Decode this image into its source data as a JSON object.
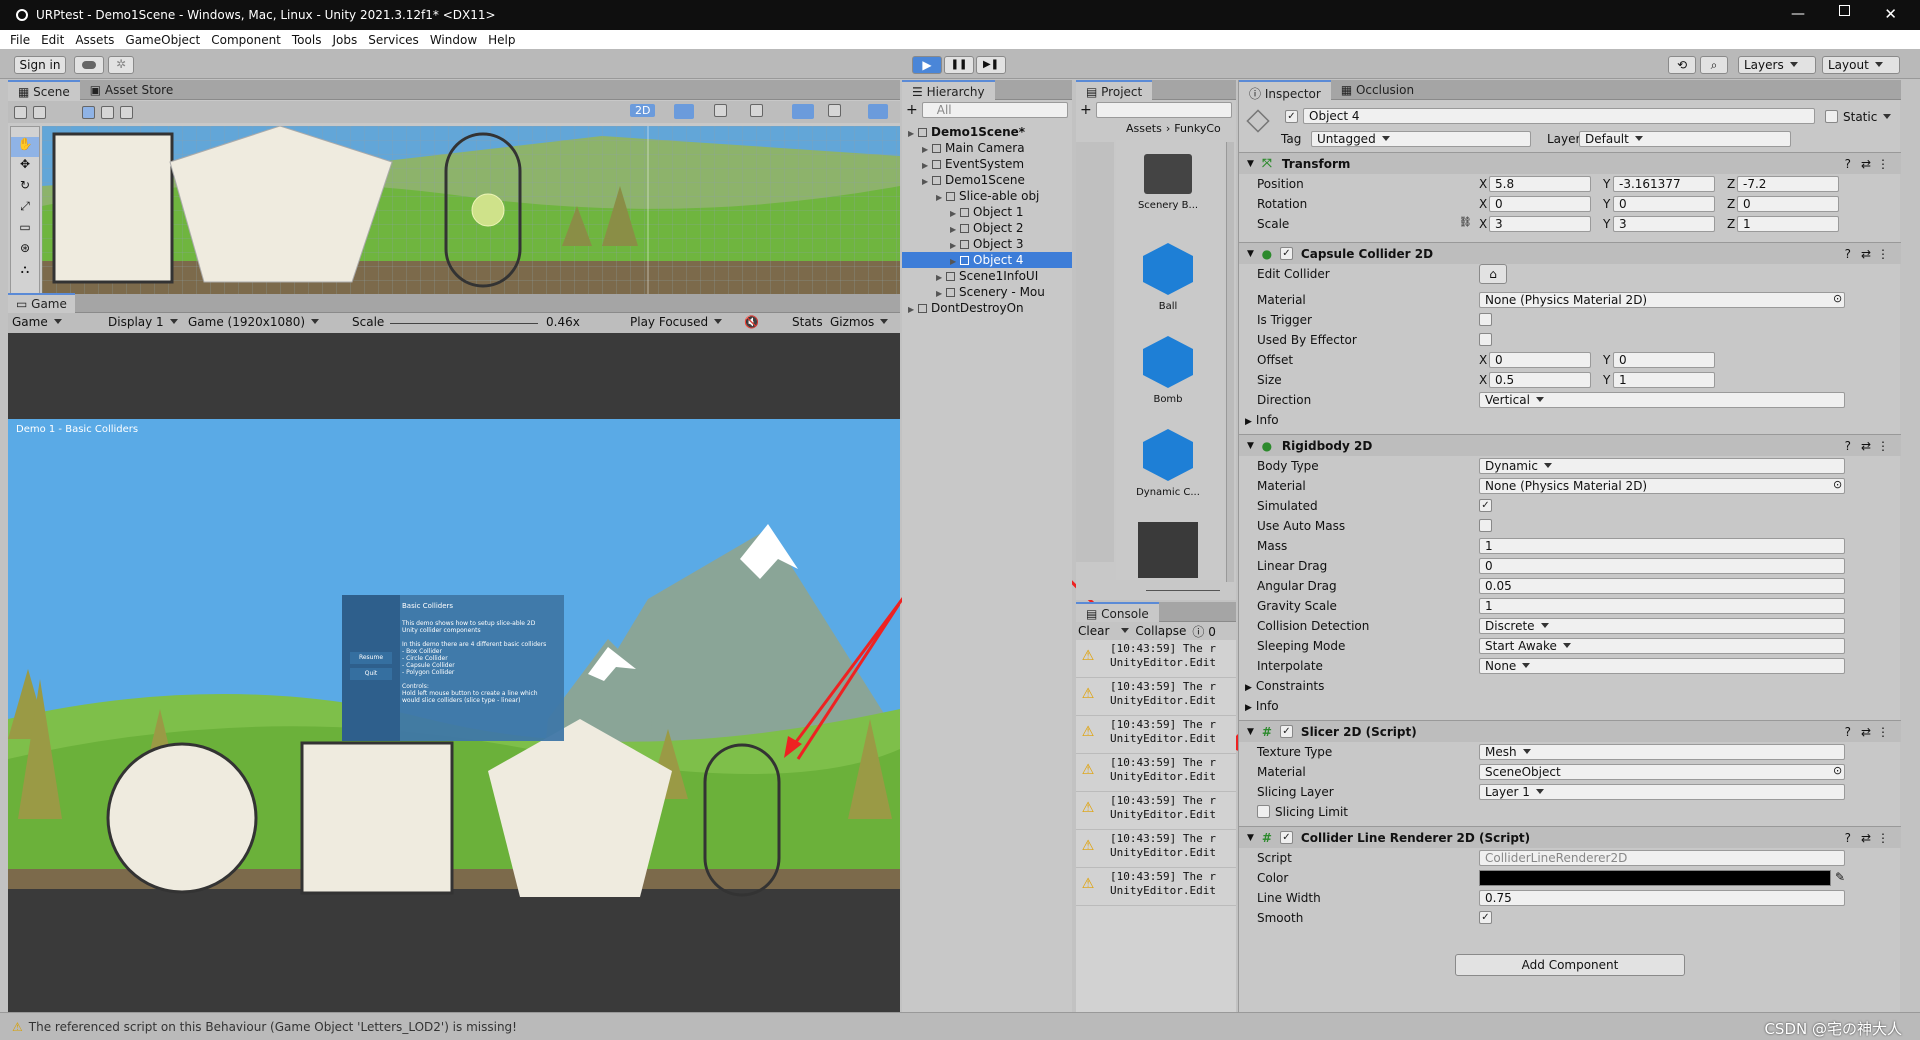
{
  "titlebar": {
    "title": "URPtest - Demo1Scene - Windows, Mac, Linux - Unity 2021.3.12f1* <DX11>"
  },
  "menu": [
    "File",
    "Edit",
    "Assets",
    "GameObject",
    "Component",
    "Tools",
    "Jobs",
    "Services",
    "Window",
    "Help"
  ],
  "toolbar": {
    "sign_in": "Sign in",
    "layers": "Layers",
    "layout": "Layout"
  },
  "scene": {
    "tab_scene": "Scene",
    "tab_asset_store": "Asset Store",
    "mode_2d": "2D"
  },
  "game": {
    "tab": "Game",
    "view": "Game",
    "display": "Display 1",
    "resolution": "Game (1920x1080)",
    "scale_label": "Scale",
    "scale_value": "0.46x",
    "play_focused": "Play Focused",
    "stats": "Stats",
    "gizmos": "Gizmos",
    "canvas_title": "Demo 1 - Basic Colliders",
    "menu_title": "Basic Colliders",
    "menu_text": [
      "This demo shows how to setup slice-able 2D",
      "Unity collider components",
      "",
      "In this demo there are 4 different basic colliders",
      "- Box Collider",
      "- Circle Collider",
      "- Capsule Collider",
      "- Polygon Collider",
      "",
      "Controls:",
      "Hold left mouse button to create a line which",
      "would slice colliders (slice type - linear)"
    ],
    "resume": "Resume",
    "quit": "Quit"
  },
  "hierarchy": {
    "tab": "Hierarchy",
    "search": "All",
    "items": [
      {
        "label": "Demo1Scene*",
        "depth": 0,
        "bold": true
      },
      {
        "label": "Main Camera",
        "depth": 1
      },
      {
        "label": "EventSystem",
        "depth": 1
      },
      {
        "label": "Demo1Scene",
        "depth": 1
      },
      {
        "label": "Slice-able obj",
        "depth": 2
      },
      {
        "label": "Object 1",
        "depth": 3
      },
      {
        "label": "Object 2",
        "depth": 3
      },
      {
        "label": "Object 3",
        "depth": 3
      },
      {
        "label": "Object 4",
        "depth": 3,
        "selected": true
      },
      {
        "label": "Scene1InfoUI",
        "depth": 2
      },
      {
        "label": "Scenery - Mou",
        "depth": 2
      },
      {
        "label": "DontDestroyOn",
        "depth": 0
      }
    ]
  },
  "project": {
    "tab": "Project",
    "breadcrumb_root": "Assets",
    "breadcrumb_child": "FunkyCo",
    "assets": [
      {
        "label": "Scenery B...",
        "kind": "folder"
      },
      {
        "label": "Ball",
        "kind": "cube"
      },
      {
        "label": "Bomb",
        "kind": "cube"
      },
      {
        "label": "Dynamic C...",
        "kind": "cube"
      },
      {
        "label": "",
        "kind": "image"
      }
    ]
  },
  "console": {
    "tab": "Console",
    "clear": "Clear",
    "collapse": "Collapse",
    "count": "0",
    "entries": [
      {
        "line1": "[10:43:59] The r",
        "line2": "UnityEditor.Edit"
      },
      {
        "line1": "[10:43:59] The r",
        "line2": "UnityEditor.Edit"
      },
      {
        "line1": "[10:43:59] The r",
        "line2": "UnityEditor.Edit"
      },
      {
        "line1": "[10:43:59] The r",
        "line2": "UnityEditor.Edit"
      },
      {
        "line1": "[10:43:59] The r",
        "line2": "UnityEditor.Edit"
      },
      {
        "line1": "[10:43:59] The r",
        "line2": "UnityEditor.Edit"
      },
      {
        "line1": "[10:43:59] The r",
        "line2": "UnityEditor.Edit"
      }
    ]
  },
  "inspector": {
    "tab": "Inspector",
    "tab2": "Occlusion",
    "object_name": "Object 4",
    "static": "Static",
    "tag_label": "Tag",
    "tag": "Untagged",
    "layer_label": "Layer",
    "layer": "Default",
    "transform": {
      "title": "Transform",
      "position_label": "Position",
      "rotation_label": "Rotation",
      "scale_label": "Scale",
      "position": [
        "5.8",
        "-3.161377",
        "-7.2"
      ],
      "rotation": [
        "0",
        "0",
        "0"
      ],
      "scale": [
        "3",
        "3",
        "1"
      ]
    },
    "capsule": {
      "title": "Capsule Collider 2D",
      "edit_collider": "Edit Collider",
      "material_label": "Material",
      "material": "None (Physics Material 2D)",
      "is_trigger": "Is Trigger",
      "used_by_effector": "Used By Effector",
      "offset_label": "Offset",
      "offset": [
        "0",
        "0"
      ],
      "size_label": "Size",
      "size": [
        "0.5",
        "1"
      ],
      "direction_label": "Direction",
      "direction": "Vertical",
      "info": "Info"
    },
    "rigidbody": {
      "title": "Rigidbody 2D",
      "body_type_label": "Body Type",
      "body_type": "Dynamic",
      "material_label": "Material",
      "material": "None (Physics Material 2D)",
      "simulated": "Simulated",
      "use_auto_mass": "Use Auto Mass",
      "mass_label": "Mass",
      "mass": "1",
      "linear_drag_label": "Linear Drag",
      "linear_drag": "0",
      "angular_drag_label": "Angular Drag",
      "angular_drag": "0.05",
      "gravity_scale_label": "Gravity Scale",
      "gravity_scale": "1",
      "collision_detection_label": "Collision Detection",
      "collision_detection": "Discrete",
      "sleeping_mode_label": "Sleeping Mode",
      "sleeping_mode": "Start Awake",
      "interpolate_label": "Interpolate",
      "interpolate": "None",
      "constraints": "Constraints",
      "info": "Info"
    },
    "slicer": {
      "title": "Slicer 2D (Script)",
      "texture_type_label": "Texture Type",
      "texture_type": "Mesh",
      "material_label": "Material",
      "material": "SceneObject",
      "slicing_layer_label": "Slicing Layer",
      "slicing_layer": "Layer 1",
      "slicing_limit": "Slicing Limit"
    },
    "line_renderer": {
      "title": "Collider Line Renderer 2D (Script)",
      "script_label": "Script",
      "script": "ColliderLineRenderer2D",
      "color_label": "Color",
      "line_width_label": "Line Width",
      "line_width": "0.75",
      "smooth": "Smooth"
    },
    "add_component": "Add Component"
  },
  "statusbar": {
    "message": "The referenced script on this Behaviour (Game Object 'Letters_LOD2') is missing!",
    "watermark": "CSDN @宅の神大人"
  },
  "xyz": [
    "X",
    "Y",
    "Z"
  ]
}
